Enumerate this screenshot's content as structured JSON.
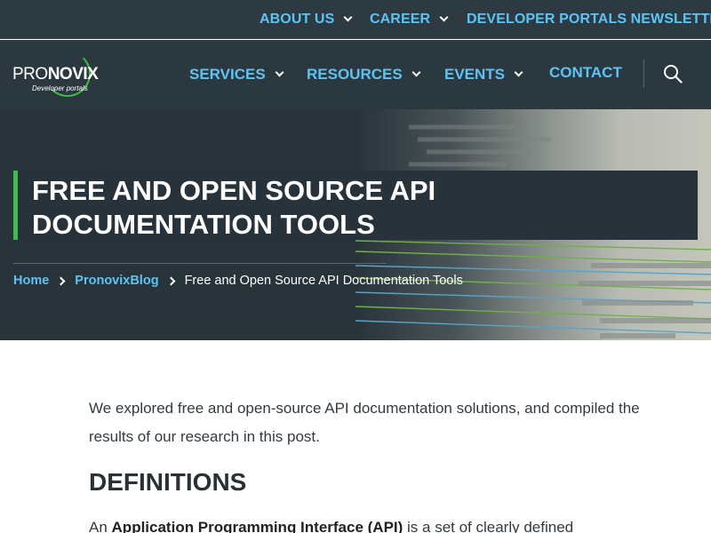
{
  "top_nav": {
    "items": [
      {
        "label": "ABOUT US",
        "has_dropdown": true
      },
      {
        "label": "CAREER",
        "has_dropdown": true
      },
      {
        "label": "DEVELOPER PORTALS NEWSLETTER",
        "has_dropdown": false
      }
    ]
  },
  "logo": {
    "part1": "PRO",
    "part2": "NOVIX",
    "tagline": "Developer portals"
  },
  "main_nav": {
    "items": [
      {
        "label": "SERVICES",
        "has_dropdown": true
      },
      {
        "label": "RESOURCES",
        "has_dropdown": true
      },
      {
        "label": "EVENTS",
        "has_dropdown": true
      },
      {
        "label": "CONTACT",
        "has_dropdown": false
      }
    ],
    "search_icon": "search-icon"
  },
  "hero": {
    "title": "FREE AND OPEN SOURCE API DOCUMENTATION TOOLS",
    "breadcrumb": {
      "home": "Home",
      "blog": "PronovixBlog",
      "current": "Free and Open Source API Documentation Tools"
    }
  },
  "article": {
    "intro": "We explored free and open-source API documentation solutions, and compiled the results of our research in this post.",
    "heading": "DEFINITIONS",
    "para_start": "An ",
    "para_bold": "Application Programming Interface (API)",
    "para_rest": " is a set of clearly defined"
  },
  "colors": {
    "nav_bg": "#2e3a42",
    "link_blue": "#5cc4f5",
    "accent_green": "#3cbe48",
    "hero_bg": "#28333a"
  }
}
